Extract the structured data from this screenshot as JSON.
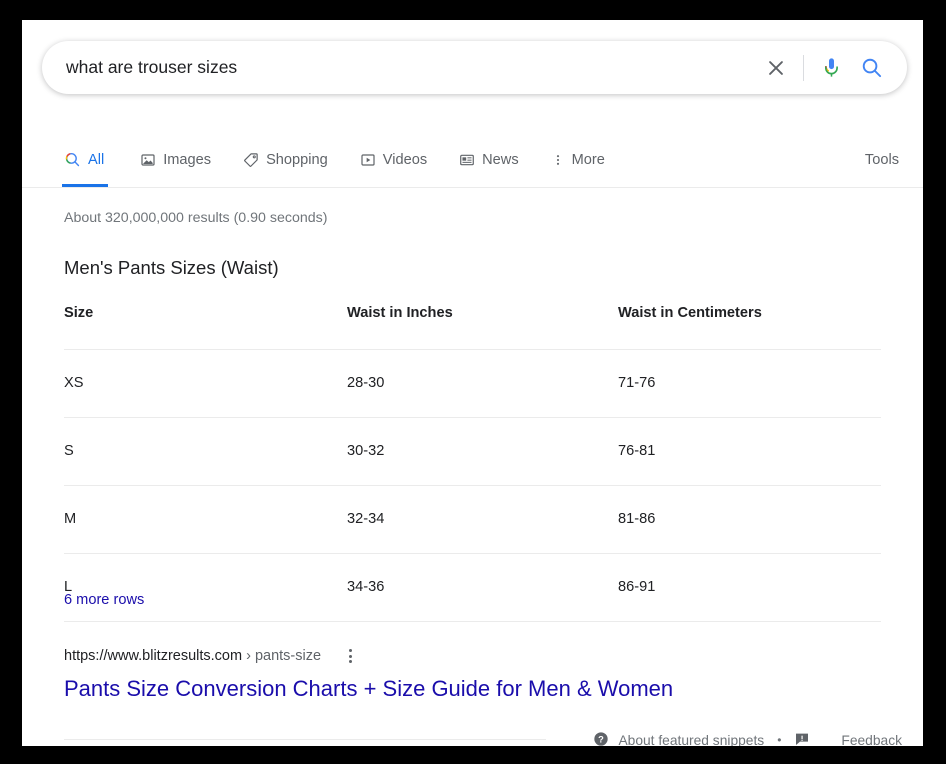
{
  "search": {
    "query": "what are trouser sizes",
    "placeholder": "Search",
    "clear_icon": "close-icon",
    "voice_icon": "microphone-icon",
    "search_icon": "search-icon"
  },
  "nav": {
    "tabs": [
      {
        "label": "All",
        "icon": "search-icon",
        "active": true
      },
      {
        "label": "Images",
        "icon": "image-icon",
        "active": false
      },
      {
        "label": "Shopping",
        "icon": "tag-icon",
        "active": false
      },
      {
        "label": "Videos",
        "icon": "video-icon",
        "active": false
      },
      {
        "label": "News",
        "icon": "newspaper-icon",
        "active": false
      },
      {
        "label": "More",
        "icon": "more-vertical-icon",
        "active": false
      }
    ],
    "tools_label": "Tools"
  },
  "results": {
    "count_text": "About 320,000,000 results (0.90 seconds)",
    "snippet_title": "Men's Pants Sizes (Waist)",
    "table": {
      "headers": [
        "Size",
        "Waist in Inches",
        "Waist in Centimeters"
      ],
      "rows": [
        [
          "XS",
          "28-30",
          "71-76"
        ],
        [
          "S",
          "30-32",
          "76-81"
        ],
        [
          "M",
          "32-34",
          "81-86"
        ],
        [
          "L",
          "34-36",
          "86-91"
        ]
      ]
    },
    "more_rows_label": "6 more rows",
    "source": {
      "domain": "https://www.blitzresults.com",
      "path": " › pants-size",
      "kebab_icon": "more-vertical-icon",
      "title": "Pants Size Conversion Charts + Size Guide for Men & Women"
    }
  },
  "footer": {
    "about_icon": "help-circle-icon",
    "about_label": "About featured snippets",
    "separator": "•",
    "feedback_icon": "feedback-icon",
    "feedback_label": "Feedback"
  },
  "colors": {
    "link_blue": "#1a0dab",
    "accent_blue": "#1a73e8",
    "text_primary": "#202124",
    "text_secondary": "#70757a",
    "divider": "#ebebeb"
  }
}
